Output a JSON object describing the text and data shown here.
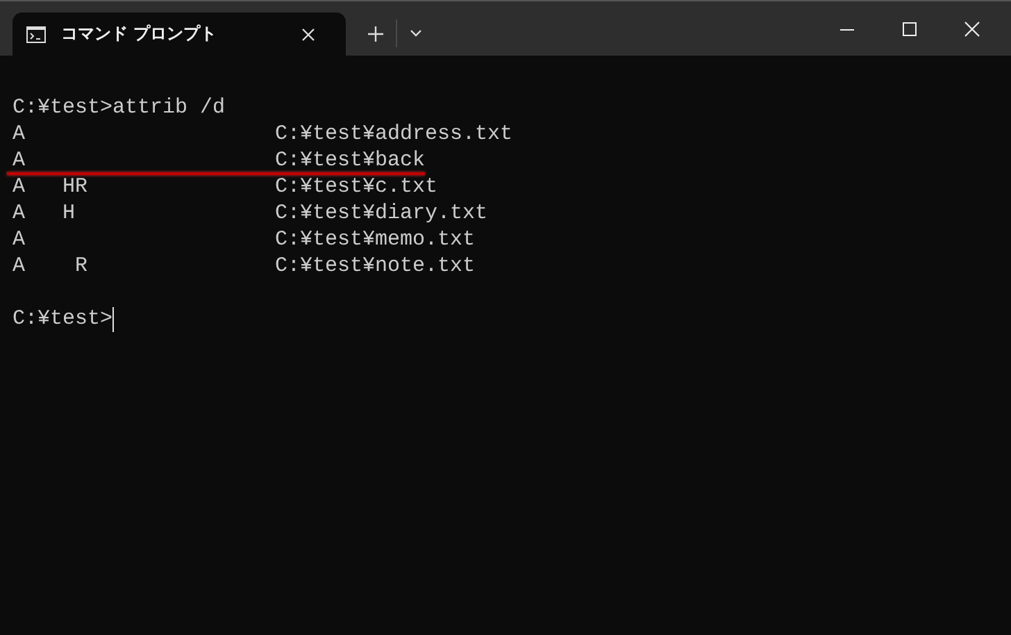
{
  "tab": {
    "title": "コマンド プロンプト",
    "selected": true
  },
  "console": {
    "command_line": "C:¥test>attrib /d",
    "rows": [
      {
        "attributes": "A",
        "path": "C:¥test¥address.txt",
        "underlined": false
      },
      {
        "attributes": "A",
        "path": "C:¥test¥back",
        "underlined": true
      },
      {
        "attributes": "A   HR",
        "path": "C:¥test¥c.txt",
        "underlined": false
      },
      {
        "attributes": "A   H",
        "path": "C:¥test¥diary.txt",
        "underlined": false
      },
      {
        "attributes": "A",
        "path": "C:¥test¥memo.txt",
        "underlined": false
      },
      {
        "attributes": "A    R",
        "path": "C:¥test¥note.txt",
        "underlined": false
      }
    ],
    "prompt": "C:¥test>"
  }
}
